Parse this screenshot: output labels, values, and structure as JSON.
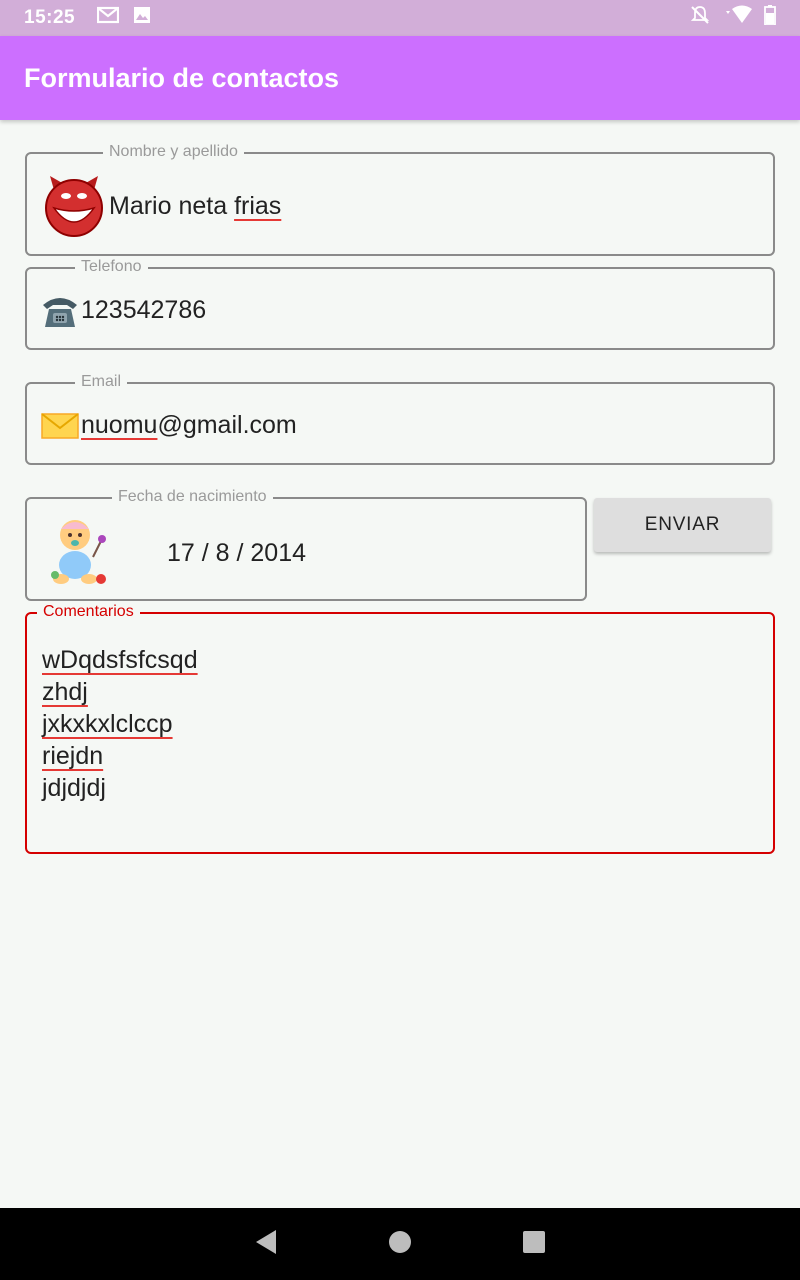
{
  "status_bar": {
    "time": "15:25",
    "left_icons": [
      "gmail-icon",
      "image-icon"
    ],
    "right_icons": [
      "notifications-off-icon",
      "wifi-icon",
      "battery-icon"
    ]
  },
  "app_bar": {
    "title": "Formulario de contactos"
  },
  "form": {
    "nombre": {
      "label": "Nombre y apellido",
      "value_plain": "Mario neta ",
      "value_misspelled": "frias",
      "icon": "devil-smiley-icon"
    },
    "telefono": {
      "label": "Telefono",
      "value": "123542786",
      "icon": "telephone-icon"
    },
    "email": {
      "label": "Email",
      "value_misspelled": "nuomu",
      "value_rest": "@gmail.com",
      "icon": "envelope-icon"
    },
    "fecha": {
      "label": "Fecha de nacimiento",
      "value": "17 / 8 / 2014",
      "icon": "baby-icon"
    },
    "enviar_label": "ENVIAR",
    "comentarios": {
      "label": "Comentarios",
      "lines": [
        "wDqdsfsfcsqd",
        "zhdj",
        "jxkxkxlclccp",
        "riejdn",
        "jdjdjdj"
      ]
    },
    "colors": {
      "accent": "#cc6fff",
      "error": "#d50000",
      "spell_underline": "#e53935"
    }
  },
  "nav_bar": {
    "buttons": [
      "back-icon",
      "home-icon",
      "recents-icon"
    ]
  }
}
